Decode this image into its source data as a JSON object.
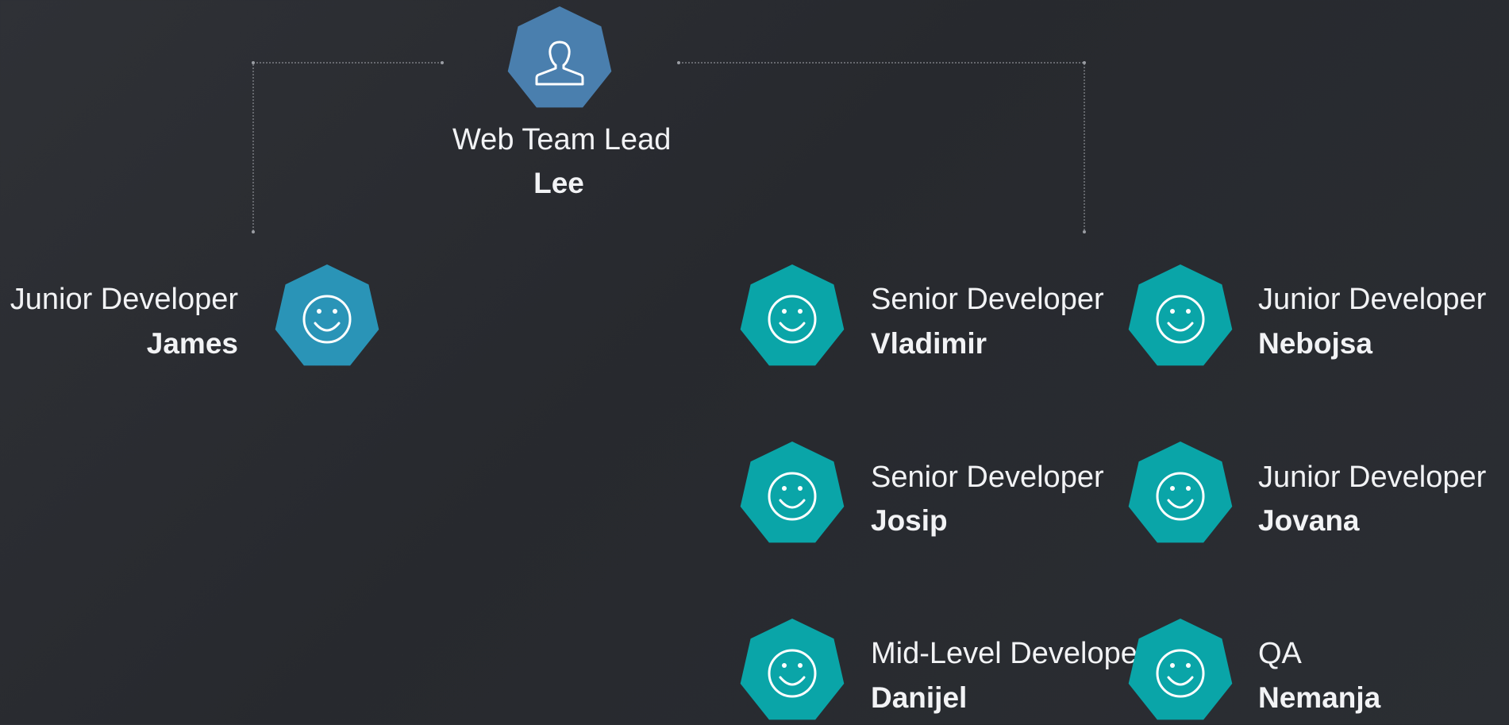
{
  "colors": {
    "lead_fill": "#4a7fae",
    "left_fill": "#2a94b7",
    "team_fill": "#0aa5a8",
    "connector": "#8a8d93",
    "icon_stroke": "#ffffff"
  },
  "lead": {
    "role": "Web Team Lead",
    "name": "Lee",
    "icon": "user-icon"
  },
  "members": [
    {
      "id": "james",
      "role": "Junior Developer",
      "name": "James",
      "icon": "smiley-icon"
    },
    {
      "id": "vladimir",
      "role": "Senior Developer",
      "name": "Vladimir",
      "icon": "smiley-icon"
    },
    {
      "id": "nebojsa",
      "role": "Junior Developer",
      "name": "Nebojsa",
      "icon": "smiley-icon"
    },
    {
      "id": "josip",
      "role": "Senior Developer",
      "name": "Josip",
      "icon": "smiley-icon"
    },
    {
      "id": "jovana",
      "role": "Junior Developer",
      "name": "Jovana",
      "icon": "smiley-icon"
    },
    {
      "id": "danijel",
      "role": "Mid-Level Developer",
      "name": "Danijel",
      "icon": "smiley-icon"
    },
    {
      "id": "nemanja",
      "role": "QA",
      "name": "Nemanja",
      "icon": "smiley-icon"
    }
  ]
}
